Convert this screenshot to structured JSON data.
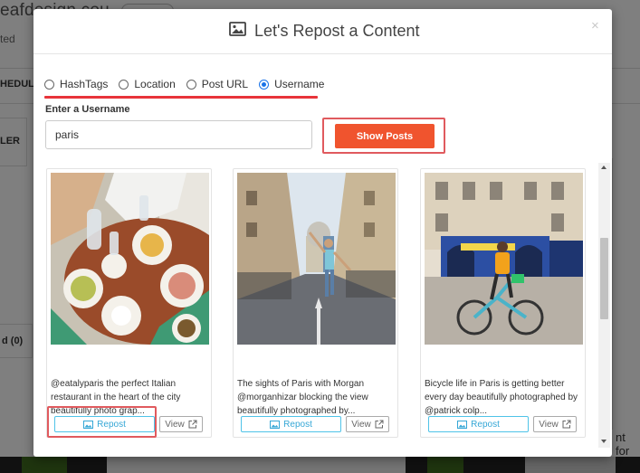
{
  "background": {
    "title_fragment": "eafdesign.cou",
    "subtitle_fragment": "ted",
    "schedule_tab_fragment": "HEDULI",
    "side_tab_fragment": "LER",
    "count_fragment": "d (0)",
    "right_fragment": "nt for"
  },
  "modal": {
    "title": "Let's Repost a Content",
    "close": "×",
    "options": [
      {
        "label": "HashTags",
        "checked": false
      },
      {
        "label": "Location",
        "checked": false
      },
      {
        "label": "Post URL",
        "checked": false
      },
      {
        "label": "Username",
        "checked": true
      }
    ],
    "input_label": "Enter a Username",
    "input_value": "paris",
    "show_button": "Show Posts",
    "posts": [
      {
        "caption": "@eatalyparis the perfect Italian restaurant in the heart of the city beautifully photo grap...",
        "repost": "Repost",
        "view": "View"
      },
      {
        "caption": "The sights of Paris with Morgan @morganhizar blocking the view beautifully photographed by...",
        "repost": "Repost",
        "view": "View"
      },
      {
        "caption": "Bicycle life in Paris is getting better every day beautifully photographed by @patrick colp...",
        "repost": "Repost",
        "view": "View"
      }
    ]
  },
  "colors": {
    "accent_orange": "#f0542e",
    "highlight_red": "#e8343a",
    "radio_blue": "#1a73e8",
    "repost_cyan": "#35a7d6"
  }
}
